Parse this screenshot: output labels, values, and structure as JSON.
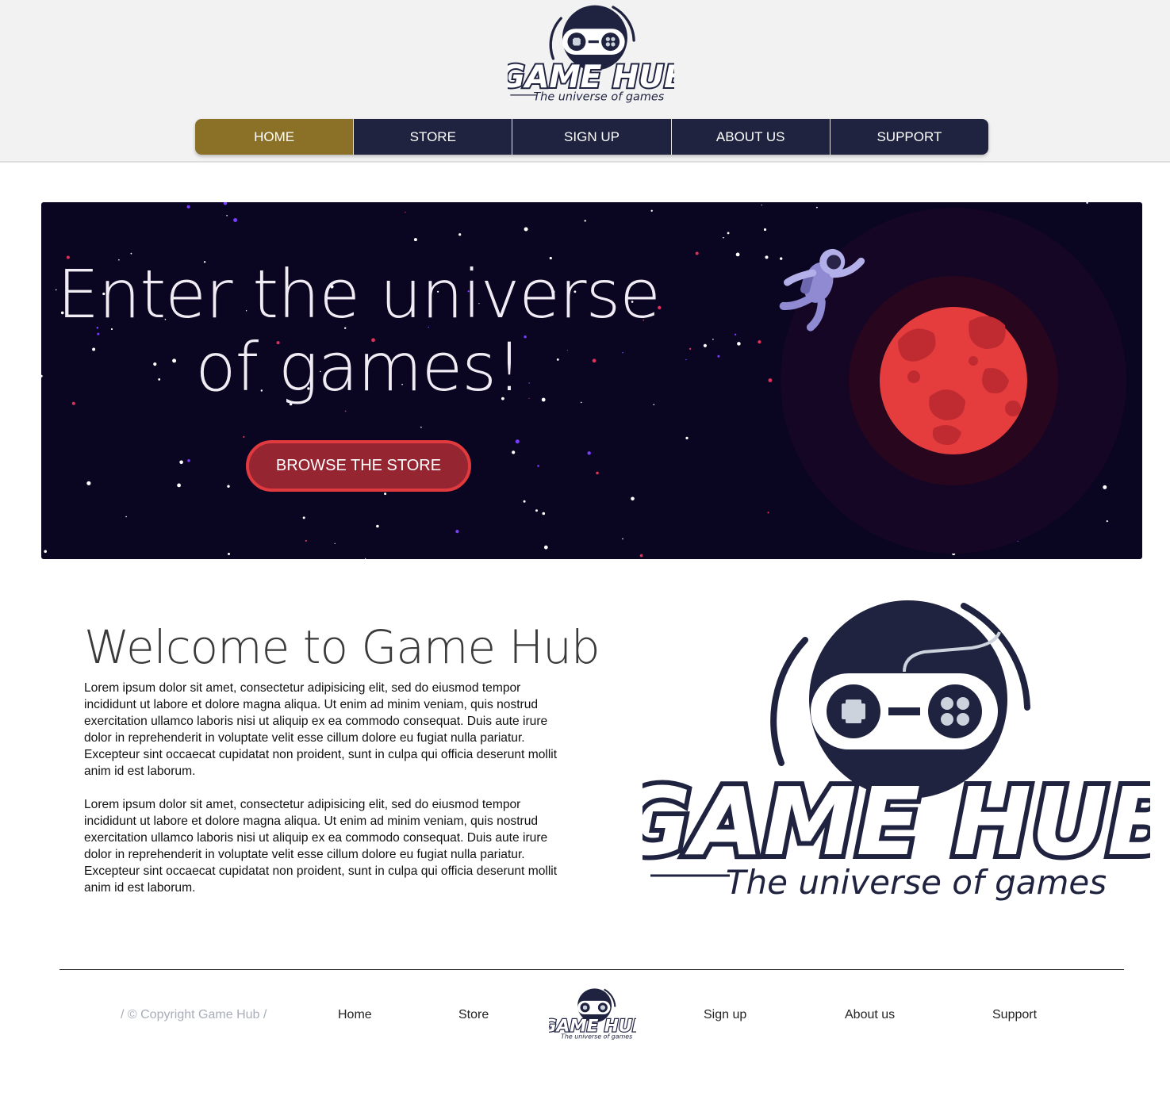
{
  "brand": {
    "name": "GAME HUB",
    "tagline": "The universe of games",
    "colors": {
      "navy": "#1f2340",
      "gold": "#8b7027",
      "hero_bg": "#0a0520",
      "planet": "#e53d3e",
      "button_fill": "#962532",
      "button_border": "#e0393e"
    }
  },
  "nav": {
    "items": [
      {
        "label": "HOME",
        "active": true
      },
      {
        "label": "STORE",
        "active": false
      },
      {
        "label": "SIGN UP",
        "active": false
      },
      {
        "label": "ABOUT US",
        "active": false
      },
      {
        "label": "SUPPORT",
        "active": false
      }
    ]
  },
  "hero": {
    "title_line1": "Enter the universe",
    "title_line2": "of games!",
    "button_label": "BROWSE THE STORE",
    "icons": [
      "astronaut-icon",
      "planet-icon",
      "stars-icon"
    ]
  },
  "welcome": {
    "title": "Welcome to Game Hub",
    "paragraphs": [
      "Lorem ipsum dolor sit amet, consectetur adipisicing elit, sed do eiusmod tempor incididunt ut labore et dolore magna aliqua. Ut enim ad minim veniam, quis nostrud exercitation ullamco laboris nisi ut aliquip ex ea commodo consequat. Duis aute irure dolor in reprehenderit in voluptate velit esse cillum dolore eu fugiat nulla pariatur. Excepteur sint occaecat cupidatat non proident, sunt in culpa qui officia deserunt mollit anim id est laborum.",
      "Lorem ipsum dolor sit amet, consectetur adipisicing elit, sed do eiusmod tempor incididunt ut labore et dolore magna aliqua. Ut enim ad minim veniam, quis nostrud exercitation ullamco laboris nisi ut aliquip ex ea commodo consequat. Duis aute irure dolor in reprehenderit in voluptate velit esse cillum dolore eu fugiat nulla pariatur. Excepteur sint occaecat cupidatat non proident, sunt in culpa qui officia deserunt mollit anim id est laborum."
    ]
  },
  "footer": {
    "copyright": "/ © Copyright Game Hub /",
    "links": [
      "Home",
      "Store",
      "Sign up",
      "About us",
      "Support"
    ]
  }
}
